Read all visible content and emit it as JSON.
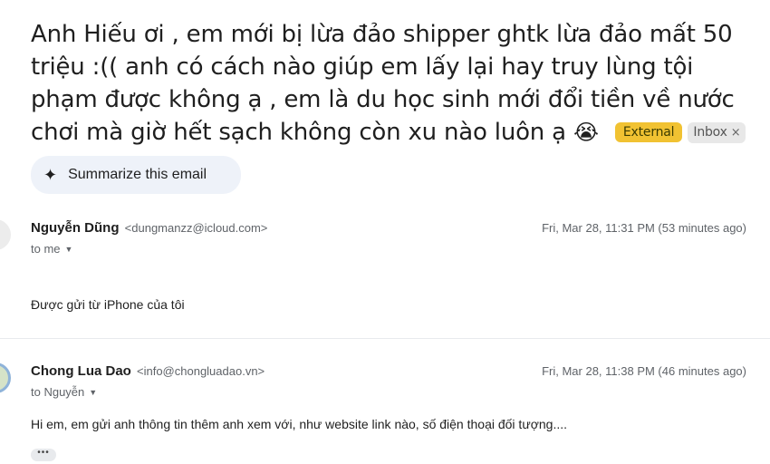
{
  "subject": {
    "text": "Anh Hiếu ơi , em mới bị lừa đảo shipper ghtk lừa đảo mất 50 triệu :(( anh có cách nào giúp em lấy lại hay truy lùng tội phạm được không ạ , em là du học sinh mới đổi tiền về nước chơi mà giờ hết sạch không còn xu nào luôn ạ",
    "emoji": "😭",
    "labels": {
      "external": "External",
      "inbox": "Inbox",
      "inbox_remove": "×"
    }
  },
  "summarize": {
    "icon": "sparkle-icon",
    "glyph": "✦",
    "label": "Summarize this email"
  },
  "messages": [
    {
      "sender_name": "Nguyễn Dũng",
      "sender_email": "<dungmanzz@icloud.com>",
      "recipient": "to me",
      "time": "Fri, Mar 28, 11:31 PM (53 minutes ago)",
      "body": "Được gửi từ iPhone của tôi"
    },
    {
      "sender_name": "Chong Lua Dao",
      "sender_email": "<info@chongluadao.vn>",
      "recipient": "to Nguyễn",
      "time": "Fri, Mar 28, 11:38 PM (46 minutes ago)",
      "body": "Hi em, em gửi anh thông tin thêm anh xem với, như website link nào, số điện thoại đối tượng....",
      "more": "•••"
    }
  ]
}
